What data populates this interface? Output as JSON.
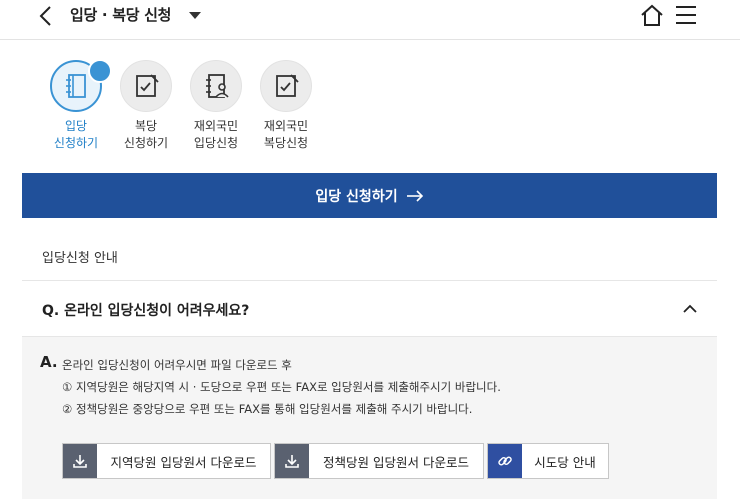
{
  "header": {
    "title": "입당 · 복당 신청",
    "back_icon": "chevron-left-icon",
    "home_icon": "home-icon",
    "menu_icon": "hamburger-menu-icon"
  },
  "options": [
    {
      "line1": "입당",
      "line2": "신청하기",
      "active": true,
      "icon": "notebook-icon"
    },
    {
      "line1": "복당",
      "line2": "신청하기",
      "active": false,
      "icon": "document-check-icon"
    },
    {
      "line1": "재외국민",
      "line2": "입당신청",
      "active": false,
      "icon": "notebook-person-icon"
    },
    {
      "line1": "재외국민",
      "line2": "복당신청",
      "active": false,
      "icon": "document-check-icon"
    }
  ],
  "cta": {
    "label": "입당 신청하기"
  },
  "guide": {
    "title": "입당신청 안내"
  },
  "faq": {
    "question": "Q. 온라인 입당신청이 어려우세요?",
    "answer_prefix": "A.",
    "answer_lines": [
      "온라인 입당신청이 어려우시면 파일 다운로드 후",
      "① 지역당원은 해당지역 시 · 도당으로 우편 또는 FAX로 입당원서를 제출해주시기 바랍니다.",
      "② 정책당원은 중앙당으로 우편 또는 FAX를 통해 입당원서를 제출해 주시기 바랍니다."
    ]
  },
  "buttons": {
    "regional_download": "지역당원 입당원서 다운로드",
    "policy_download": "정책당원 입당원서 다운로드",
    "provincial_info": "시도당 안내"
  },
  "colors": {
    "primary": "#20509a",
    "accent": "#3a93d4",
    "panel_bg": "#f5f5f5"
  }
}
